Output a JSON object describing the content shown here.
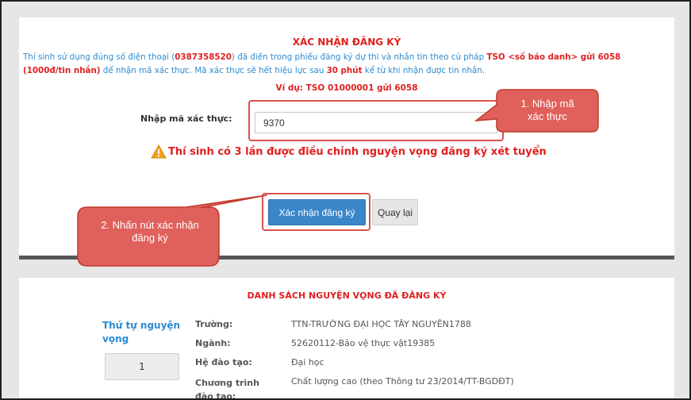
{
  "confirm": {
    "title": "XÁC NHẬN ĐĂNG KÝ",
    "notice_part1": "Thí sinh sử dụng đúng số điện thoại (",
    "phone": "0387358520",
    "notice_part2": ") đã điền trong phiếu đăng ký dự thi và nhắn tin theo cú pháp ",
    "syntax": "TSO <số báo danh> gửi 6058 (1000đ/tin nhắn)",
    "notice_part3": " để nhận mã xác thực. Mã xác thực sẽ hết hiệu lực sau ",
    "expiry": "30 phút",
    "notice_part4": " kể từ khi nhận được tin nhắn.",
    "example": "Ví dụ: TSO 01000001 gửi 6058",
    "code_label": "Nhập mã xác thực:",
    "code_value": "9370",
    "warning": "Thí sinh có 3 lần được điều chỉnh nguyện vọng đăng ký xét tuyển",
    "submit_label": "Xác nhận đăng ký",
    "back_label": "Quay lại"
  },
  "callouts": {
    "step1_line1": "1. Nhập mã",
    "step1_line2": "xác thực",
    "step2_line1": "2. Nhấn nút xác nhận",
    "step2_line2": "đăng ký"
  },
  "wishlist": {
    "title": "DANH SÁCH NGUYỆN VỌNG ĐÃ ĐĂNG KÝ",
    "order_label_line1": "Thứ tự nguyện",
    "order_label_line2": "vọng",
    "order_value": "1",
    "rows": [
      {
        "label": "Trường:",
        "value": "TTN-TRƯỜNG ĐẠI HỌC TÂY NGUYÊN1788"
      },
      {
        "label": "Ngành:",
        "value": "52620112-Bảo vệ thực vật19385"
      },
      {
        "label": "Hệ đào tạo:",
        "value": "Đại học"
      },
      {
        "label_line1": "Chương trình",
        "label_line2": "đào tạo:",
        "value": "Chất lượng cao (theo Thông tư 23/2014/TT-BGDĐT)"
      }
    ]
  },
  "colors": {
    "accent_red": "#e02020",
    "link_blue": "#2d8bd2",
    "primary_button": "#3a86c8",
    "callout_fill": "#e0605c",
    "callout_border": "#c0392b"
  }
}
